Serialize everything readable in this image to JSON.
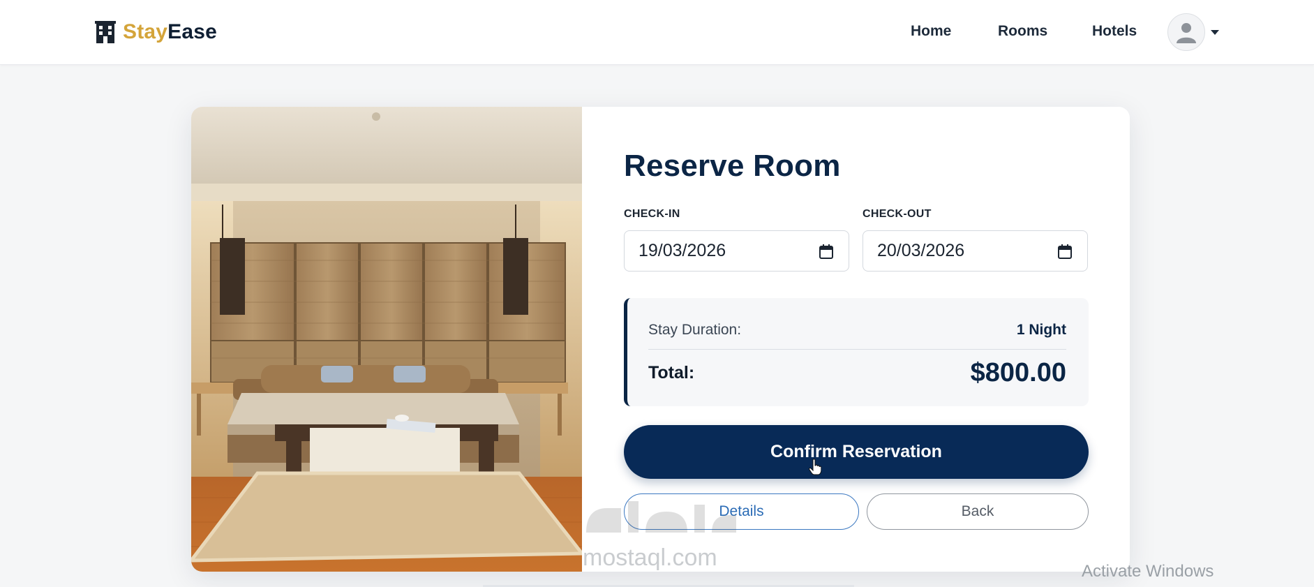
{
  "navbar": {
    "brand_accent": "Stay",
    "brand_rest": "Ease",
    "brand_icon": "building-icon",
    "links": [
      "Home",
      "Rooms",
      "Hotels"
    ],
    "avatar_icon": "user-avatar-icon",
    "avatar_caret_icon": "caret-down-icon"
  },
  "reservation": {
    "title": "Reserve Room",
    "checkin_label": "CHECK-IN",
    "checkin_value": "19/03/2026",
    "checkout_label": "CHECK-OUT",
    "checkout_value": "20/03/2026",
    "calendar_icon": "calendar-icon",
    "summary": {
      "duration_label": "Stay Duration:",
      "duration_value": "1 Night",
      "total_label": "Total:",
      "total_value": "$800.00"
    },
    "confirm_label": "Confirm Reservation",
    "details_label": "Details",
    "back_label": "Back"
  },
  "overlay": {
    "watermark_url": "mostaql.com",
    "activate_windows": "Activate Windows"
  },
  "colors": {
    "brand_accent": "#d4a43a",
    "primary_navy": "#082a57",
    "details_blue": "#2a6bb5",
    "page_bg": "#f5f6f7"
  }
}
